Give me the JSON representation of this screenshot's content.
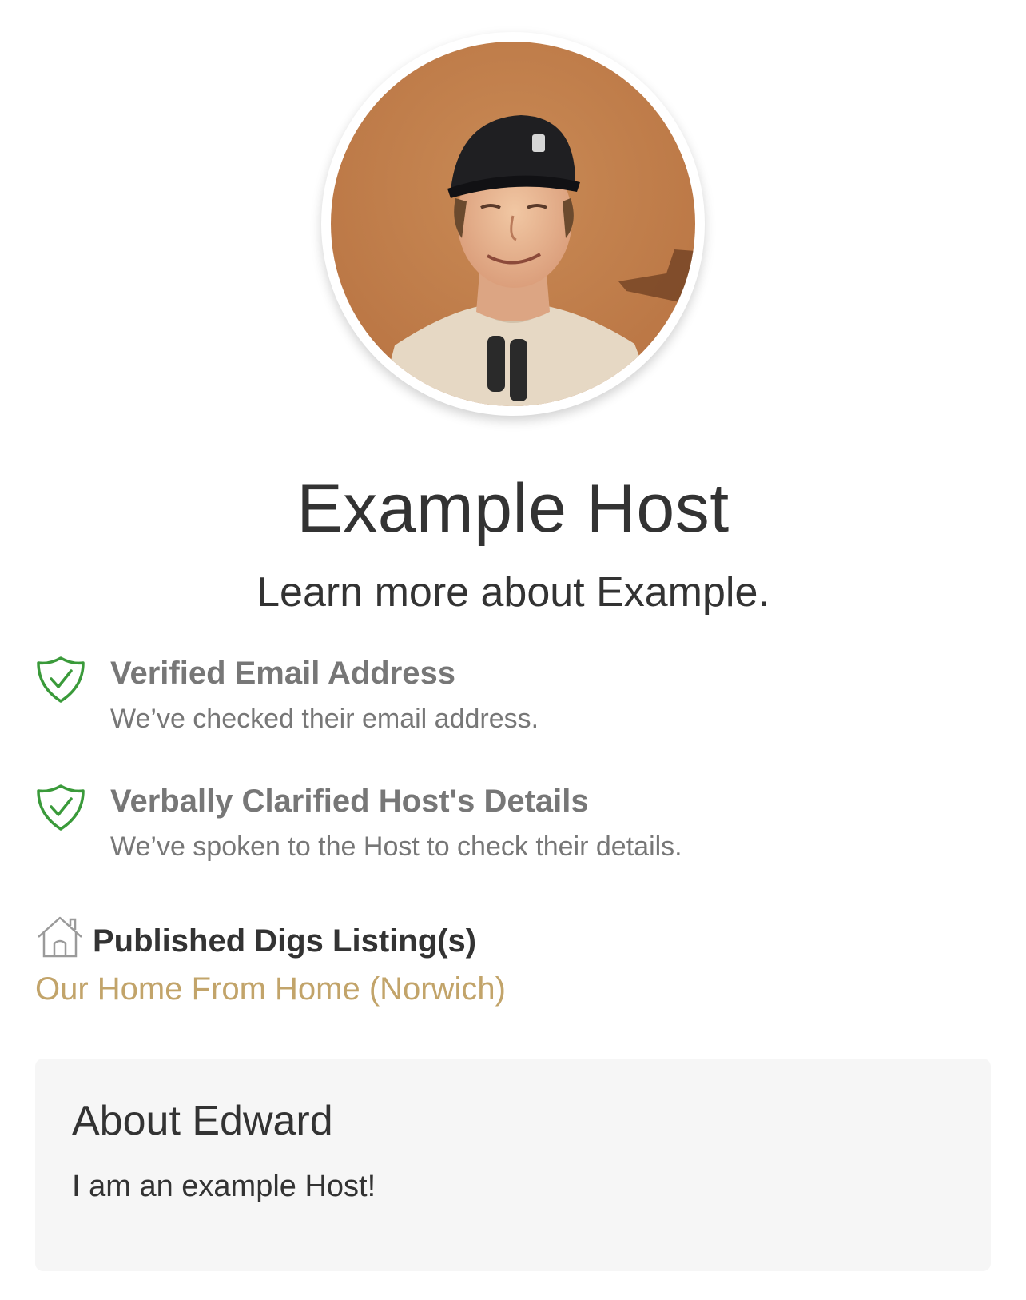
{
  "profile": {
    "name": "Example Host",
    "subtitle": "Learn more about Example."
  },
  "verifications": [
    {
      "title": "Verified Email Address",
      "description": "We’ve checked their email address.",
      "icon": "shield-check-icon"
    },
    {
      "title": "Verbally Clarified Host's Details",
      "description": "We’ve spoken to the Host to check their details.",
      "icon": "shield-check-icon"
    }
  ],
  "listings": {
    "title": "Published Digs Listing(s)",
    "icon": "house-icon",
    "items": [
      {
        "label": "Our Home From Home (Norwich)"
      }
    ]
  },
  "about": {
    "title": "About Edward",
    "text": "I am an example Host!"
  },
  "colors": {
    "verified_green": "#3a9a3a",
    "link_gold": "#c2a46a",
    "muted_text": "#777777",
    "about_background": "#f6f6f6"
  }
}
